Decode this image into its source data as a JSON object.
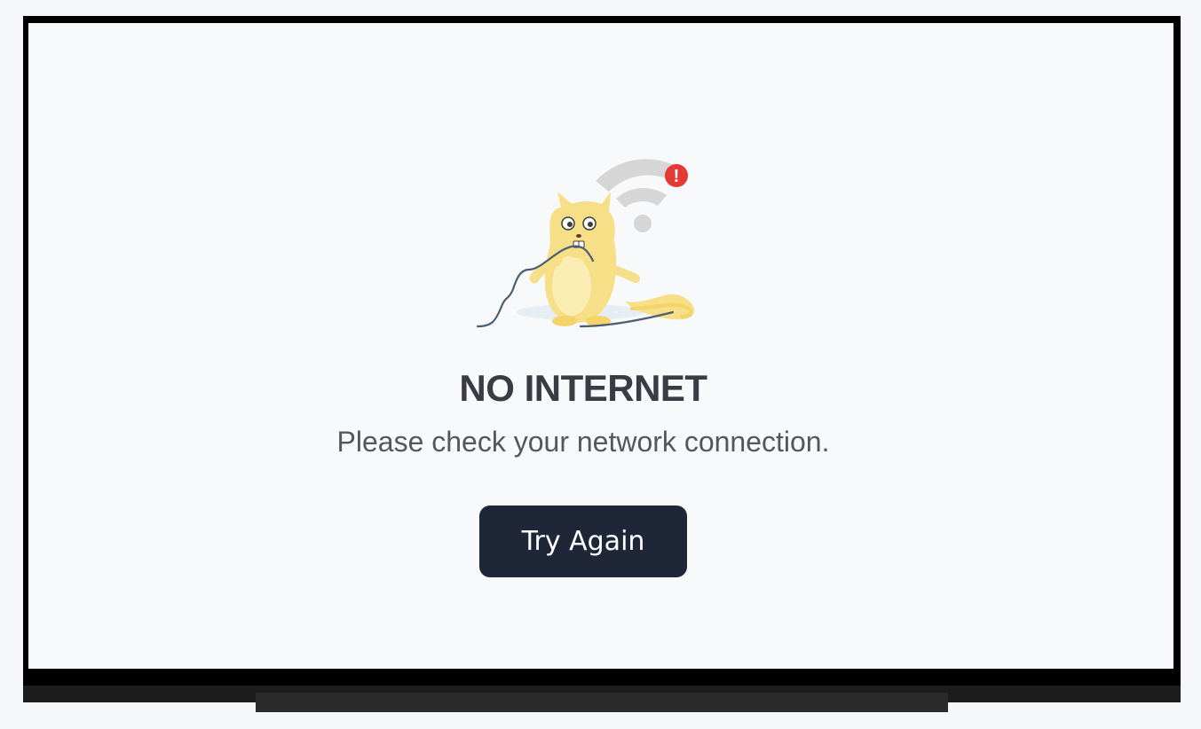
{
  "screen": {
    "illustration": {
      "subject": "cat-chewing-cable",
      "wifi_icon": "wifi-icon",
      "alert_icon": "alert-exclamation-icon",
      "alert_glyph": "!"
    },
    "title": "NO INTERNET",
    "message": "Please check your network connection.",
    "retry_button_label": "Try Again"
  },
  "colors": {
    "screen_background": "#f8f9fb",
    "title": "#3b3b45",
    "message": "#56565e",
    "button_background": "#1e2637",
    "button_text": "#ffffff",
    "alert_badge": "#e53935",
    "cat_body": "#f6df86",
    "wifi_icon": "#d6d6d6"
  }
}
